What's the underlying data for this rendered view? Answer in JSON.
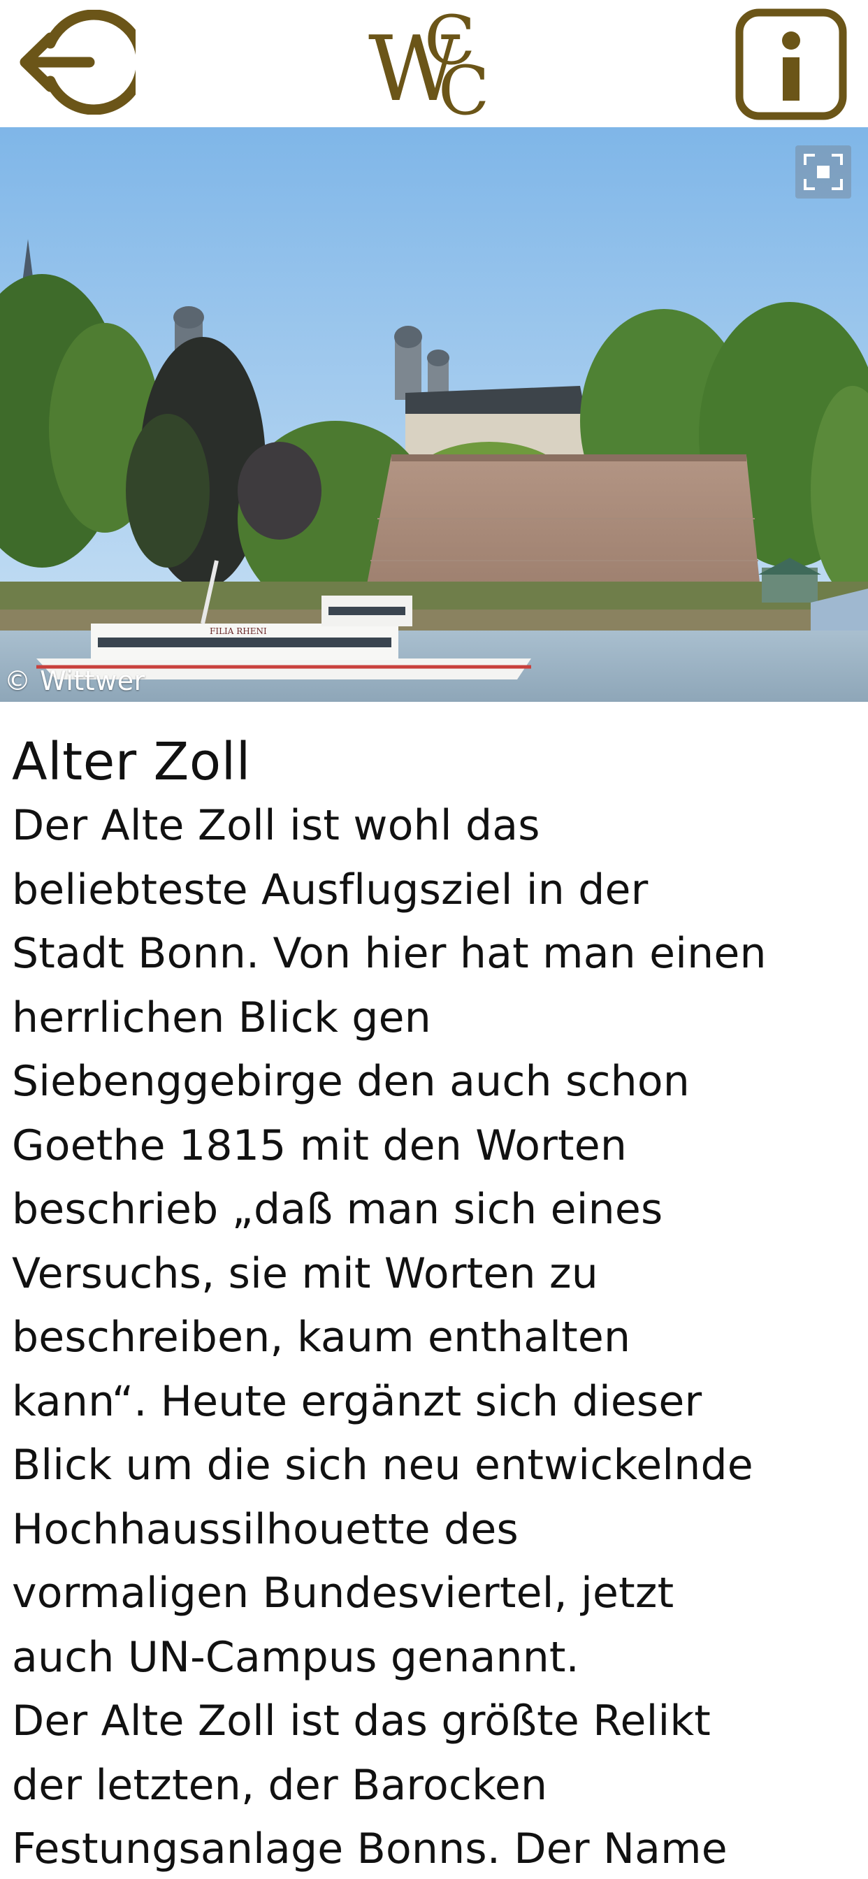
{
  "header": {
    "back_label": "",
    "logo_text": "WCC",
    "info_glyph": "i",
    "brand_color": "#6b5518"
  },
  "hero": {
    "credit": "© Wittwer",
    "ship_name": "FILIA RHENI",
    "expand_icon": "expand-icon"
  },
  "article": {
    "title": "Alter Zoll",
    "lines": [
      "Der Alte Zoll ist wohl das",
      "beliebteste Ausflugsziel in der",
      "Stadt Bonn. Von hier hat man einen",
      "herrlichen Blick gen",
      "Siebenggebirge den auch schon",
      "Goethe 1815 mit den Worten",
      "beschrieb „daß man sich eines",
      "Versuchs, sie mit Worten zu",
      "beschreiben, kaum enthalten",
      "kann“. Heute ergänzt sich dieser",
      "Blick um die sich neu entwickelnde",
      "Hochhaussilhouette des",
      "vormaligen Bundesviertel, jetzt",
      "auch UN-Campus genannt.",
      "Der Alte Zoll ist das größte Relikt",
      "der letzten, der Barocken",
      "Festungsanlage Bonns. Der Name"
    ]
  }
}
